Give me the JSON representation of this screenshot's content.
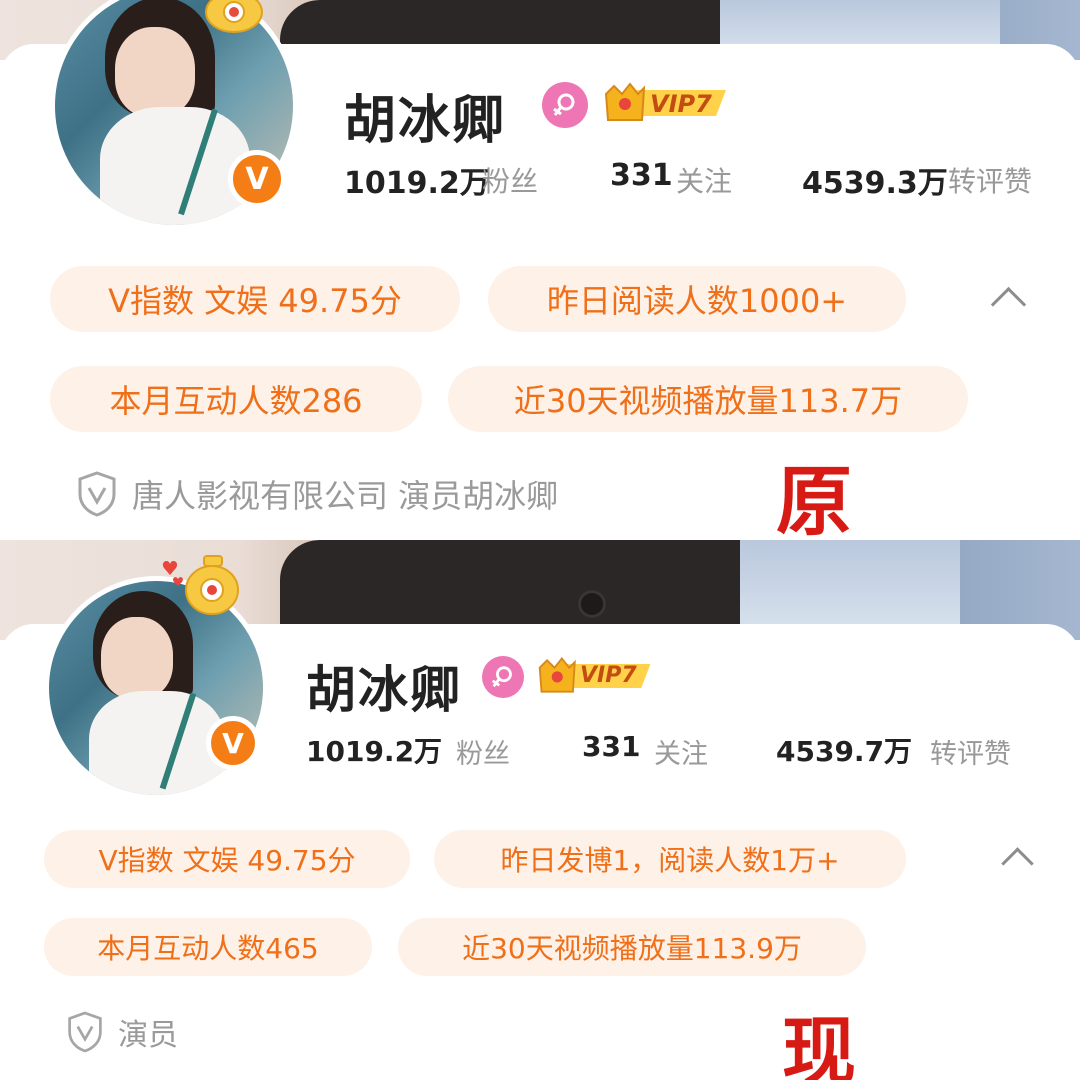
{
  "panels": [
    {
      "label": "原",
      "profile": {
        "name": "胡冰卿",
        "gender_icon": "female-icon",
        "vip": "VIP7",
        "verified_badge": "V",
        "stats": [
          {
            "value": "1019.2万",
            "label": "粉丝"
          },
          {
            "value": "331",
            "label": "关注"
          },
          {
            "value": "4539.3万",
            "label": "转评赞"
          }
        ]
      },
      "chips_row1": [
        "V指数 文娱 49.75分",
        "昨日阅读人数1000+"
      ],
      "chips_row2": [
        "本月互动人数286",
        "近30天视频播放量113.7万"
      ],
      "certification": "唐人影视有限公司 演员胡冰卿"
    },
    {
      "label": "现",
      "profile": {
        "name": "胡冰卿",
        "gender_icon": "female-icon",
        "vip": "VIP7",
        "verified_badge": "V",
        "stats": [
          {
            "value": "1019.2万",
            "label": "粉丝"
          },
          {
            "value": "331",
            "label": "关注"
          },
          {
            "value": "4539.7万",
            "label": "转评赞"
          }
        ]
      },
      "chips_row1": [
        "V指数 文娱 49.75分",
        "昨日发博1，阅读人数1万+"
      ],
      "chips_row2": [
        "本月互动人数465",
        "近30天视频播放量113.9万"
      ],
      "certification": "演员"
    }
  ],
  "colors": {
    "accent_orange": "#f06f19",
    "chip_bg": "#fdf1e8",
    "badge_orange": "#f47e15",
    "gender_pink": "#ee76b4",
    "label_red": "#d81a14"
  }
}
